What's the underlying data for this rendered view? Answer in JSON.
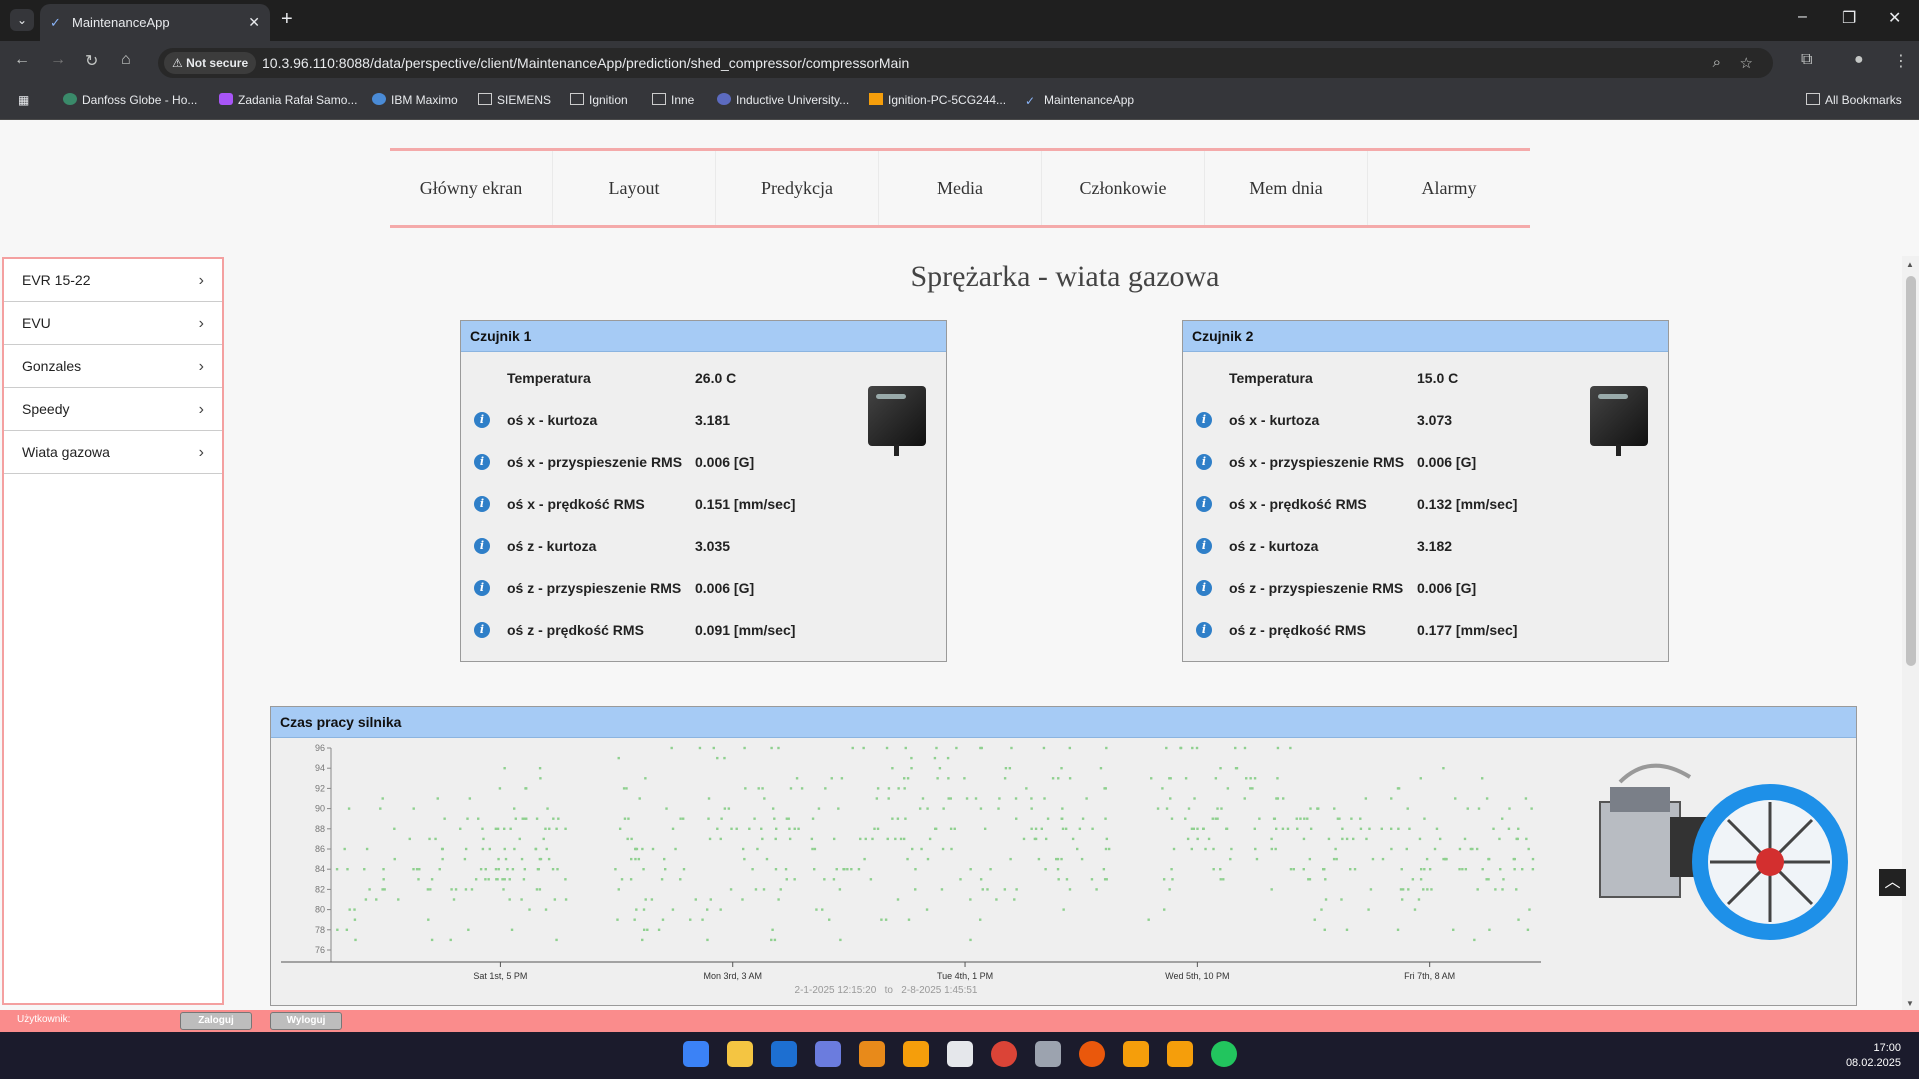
{
  "browser": {
    "tab_title": "MaintenanceApp",
    "new_tab": "+",
    "window_controls": [
      "–",
      "❐",
      "✕"
    ],
    "not_secure": "Not secure",
    "url": "10.3.96.110:8088/data/perspective/client/MaintenanceApp/prediction/shed_compressor/compressorMain",
    "bookmarks": [
      "Danfoss Globe - Ho...",
      "Zadania Rafał Samo...",
      "IBM Maximo",
      "SIEMENS",
      "Ignition",
      "Inne",
      "Inductive University...",
      "Ignition-PC-5CG244...",
      "MaintenanceApp"
    ],
    "all_bookmarks": "All Bookmarks"
  },
  "nav": {
    "items": [
      "Główny ekran",
      "Layout",
      "Predykcja",
      "Media",
      "Członkowie",
      "Mem dnia",
      "Alarmy"
    ]
  },
  "sidebar": {
    "items": [
      "EVR 15-22",
      "EVU",
      "Gonzales",
      "Speedy",
      "Wiata gazowa"
    ]
  },
  "page": {
    "title": "Sprężarka - wiata gazowa"
  },
  "sensors": [
    {
      "title": "Czujnik 1",
      "rows": [
        {
          "label": "Temperatura",
          "value": "26.0 C"
        },
        {
          "label": "oś x - kurtoza",
          "value": "3.181"
        },
        {
          "label": "oś x - przyspieszenie RMS",
          "value": "0.006 [G]"
        },
        {
          "label": "oś x - prędkość RMS",
          "value": "0.151 [mm/sec]"
        },
        {
          "label": "oś z - kurtoza",
          "value": "3.035"
        },
        {
          "label": "oś z - przyspieszenie RMS",
          "value": "0.006 [G]"
        },
        {
          "label": "oś z - prędkość RMS",
          "value": "0.091 [mm/sec]"
        }
      ]
    },
    {
      "title": "Czujnik 2",
      "rows": [
        {
          "label": "Temperatura",
          "value": "15.0 C"
        },
        {
          "label": "oś x - kurtoza",
          "value": "3.073"
        },
        {
          "label": "oś x - przyspieszenie RMS",
          "value": "0.006 [G]"
        },
        {
          "label": "oś x - prędkość RMS",
          "value": "0.132 [mm/sec]"
        },
        {
          "label": "oś z - kurtoza",
          "value": "3.182"
        },
        {
          "label": "oś z - przyspieszenie RMS",
          "value": "0.006 [G]"
        },
        {
          "label": "oś z - prędkość RMS",
          "value": "0.177 [mm/sec]"
        }
      ]
    }
  ],
  "chart_panel": {
    "title": "Czas pracy silnika",
    "range_from": "2-1-2025    12:15:20",
    "range_to_label": "to",
    "range_to": "2-8-2025    1:45:51"
  },
  "chart_data": {
    "type": "scatter",
    "title": "",
    "ylim": [
      76,
      96
    ],
    "yticks": [
      76,
      78,
      80,
      82,
      84,
      86,
      88,
      90,
      92,
      94,
      96
    ],
    "xlim": [
      0,
      100
    ],
    "xticks": [
      {
        "x": 14,
        "label": "Sat 1st, 5 PM"
      },
      {
        "x": 33.2,
        "label": "Mon 3rd, 3 AM"
      },
      {
        "x": 52.4,
        "label": "Tue 4th, 1 PM"
      },
      {
        "x": 71.6,
        "label": "Wed 5th, 10 PM"
      },
      {
        "x": 90.8,
        "label": "Fri 7th, 8 AM"
      }
    ],
    "color": "#8fd08f",
    "point_count": 620,
    "segments": [
      {
        "from": 0.5,
        "to": 19.5,
        "center": 85,
        "spread": 3.5
      },
      {
        "from": 23.5,
        "to": 43,
        "center": 86,
        "spread": 4.5
      },
      {
        "from": 43,
        "to": 64.5,
        "center": 88,
        "spread": 4.5
      },
      {
        "from": 67.5,
        "to": 80,
        "center": 88,
        "spread": 4.5
      },
      {
        "from": 80,
        "to": 99.5,
        "center": 85.5,
        "spread": 3.8
      }
    ]
  },
  "footer": {
    "user_label": "Użytkownik:",
    "login": "Zaloguj",
    "logout": "Wyloguj"
  },
  "clock": {
    "time": "17:00",
    "date": "08.02.2025"
  },
  "colors": {
    "accent": "#fa8c8c",
    "card_header": "#a6cbf5",
    "info": "#2f7fc8"
  }
}
